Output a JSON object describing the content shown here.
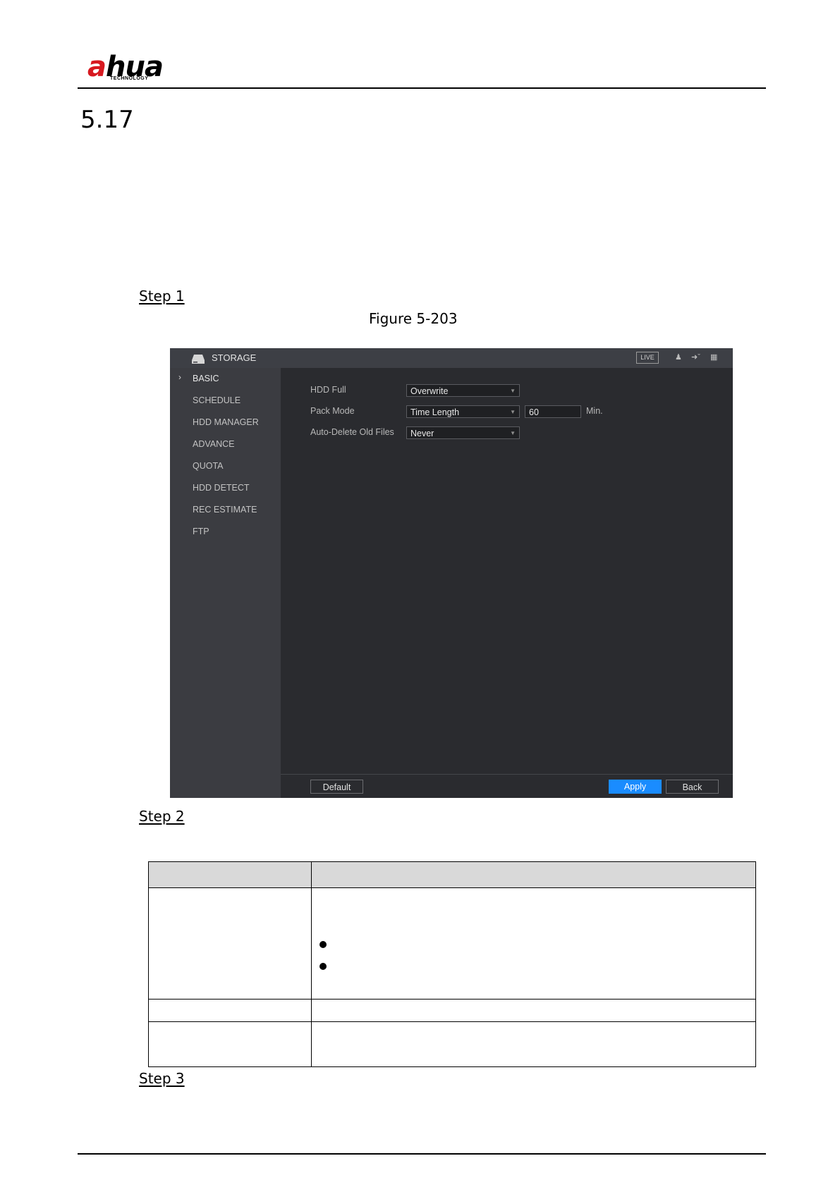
{
  "header": {
    "logo_text_a": "a",
    "logo_text_rest": "hua",
    "logo_subtext": "TECHNOLOGY"
  },
  "section": {
    "number": "5.17"
  },
  "steps": {
    "step1": "Step 1",
    "step2": "Step 2",
    "step3": "Step 3"
  },
  "figure": {
    "caption": "Figure 5-203"
  },
  "dvr_ui": {
    "title": "STORAGE",
    "live_badge": "LIVE",
    "icons": [
      "storage-drive-icon",
      "user-icon",
      "logout-icon",
      "grid-menu-icon"
    ],
    "sidebar": {
      "active_chevron": "›",
      "items": [
        {
          "label": "BASIC",
          "active": true
        },
        {
          "label": "SCHEDULE",
          "active": false
        },
        {
          "label": "HDD MANAGER",
          "active": false
        },
        {
          "label": "ADVANCE",
          "active": false
        },
        {
          "label": "QUOTA",
          "active": false
        },
        {
          "label": "HDD DETECT",
          "active": false
        },
        {
          "label": "REC ESTIMATE",
          "active": false
        },
        {
          "label": "FTP",
          "active": false
        }
      ]
    },
    "fields": {
      "hdd_full": {
        "label": "HDD Full",
        "value": "Overwrite"
      },
      "pack_mode": {
        "label": "Pack Mode",
        "value": "Time Length",
        "minutes": "60",
        "unit": "Min."
      },
      "auto_delete": {
        "label": "Auto-Delete Old Files",
        "value": "Never"
      }
    },
    "buttons": {
      "default": "Default",
      "apply": "Apply",
      "back": "Back"
    },
    "colors": {
      "panel": "#2a2b2f",
      "sidebar": "#3b3c41",
      "accent": "#1a8cff"
    }
  }
}
